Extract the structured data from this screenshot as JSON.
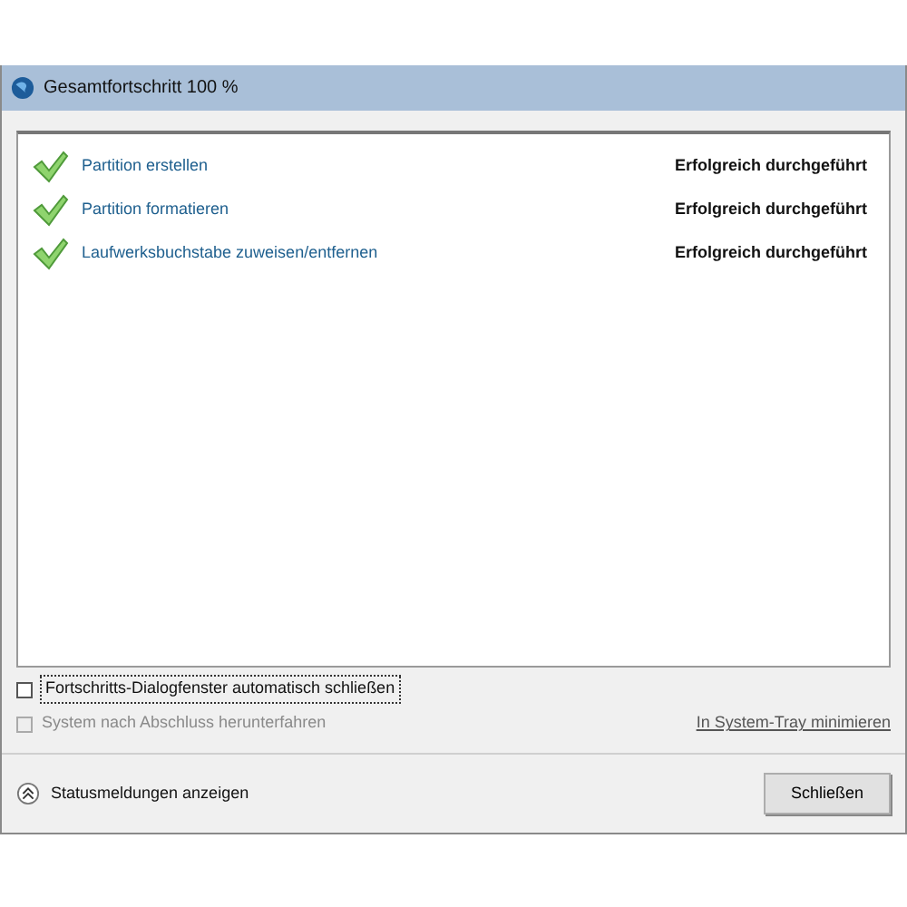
{
  "window": {
    "title": "Gesamtfortschritt 100 %"
  },
  "tasks": [
    {
      "name": "Partition erstellen",
      "status": "Erfolgreich durchgeführt",
      "done": true
    },
    {
      "name": "Partition formatieren",
      "status": "Erfolgreich durchgeführt",
      "done": true
    },
    {
      "name": "Laufwerksbuchstabe zuweisen/entfernen",
      "status": "Erfolgreich durchgeführt",
      "done": true
    }
  ],
  "options": [
    {
      "label": "Fortschritts-Dialogfenster automatisch schließen",
      "checked": false,
      "disabled": false,
      "focused": true
    },
    {
      "label": "System nach Abschluss herunterfahren",
      "checked": false,
      "disabled": true,
      "focused": false
    }
  ],
  "tray_link": "In System-Tray minimieren",
  "details_toggle": {
    "label": "Statusmeldungen anzeigen",
    "expanded": false
  },
  "buttons": [
    "Schließen"
  ]
}
